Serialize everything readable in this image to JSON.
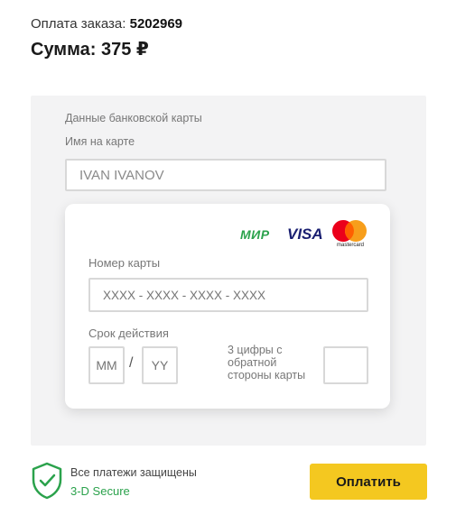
{
  "order": {
    "label": "Оплата заказа:",
    "number": "5202969",
    "sum_label": "Сумма: 375 ₽"
  },
  "form": {
    "section_title": "Данные банковской карты",
    "holder_label": "Имя на карте",
    "holder_value": "IVAN IVANOV",
    "card_number_label": "Номер карты",
    "card_number_placeholder": "XXXX - XXXX - XXXX - XXXX",
    "expiry_label": "Срок действия",
    "month_placeholder": "MM",
    "year_placeholder": "YY",
    "slash": "/",
    "cvv_label": "3 цифры с обратной стороны карты"
  },
  "brands": {
    "mir": "МИР",
    "visa": "VISA",
    "mastercard": "mastercard",
    "colors": {
      "mir": "#2ba24c",
      "visa": "#1a1f71",
      "mc_red": "#eb001b",
      "mc_yellow": "#f79e1b"
    }
  },
  "security": {
    "text": "Все платежи защищены",
    "badge": "3-D Secure",
    "icon": "shield-check-icon"
  },
  "actions": {
    "pay_label": "Оплатить"
  },
  "colors": {
    "accent_button": "#f4c820",
    "secure_green": "#2ba24c",
    "panel_bg": "#f3f3f4"
  }
}
